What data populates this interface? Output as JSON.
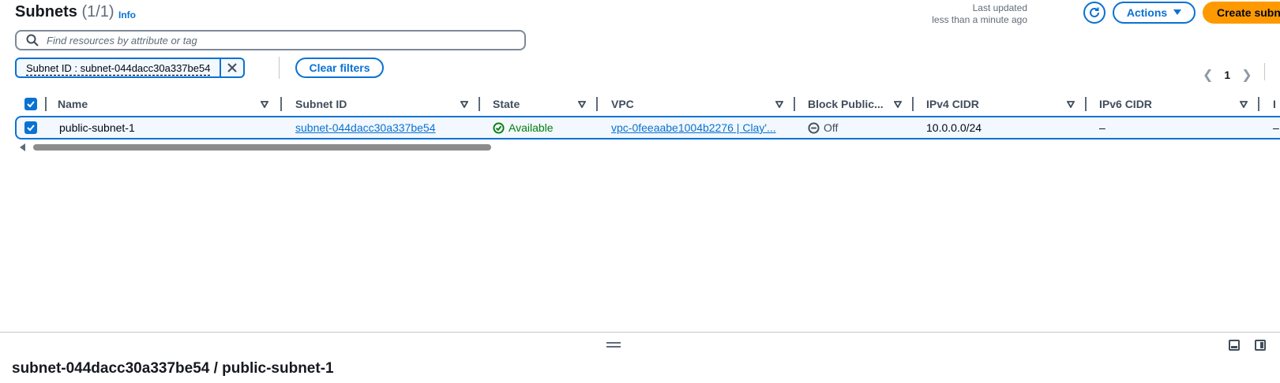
{
  "header": {
    "title": "Subnets",
    "count": "(1/1)",
    "info": "Info",
    "last_updated_label": "Last updated",
    "last_updated_value": "less than a minute ago",
    "actions_label": "Actions",
    "create_label": "Create subnet"
  },
  "search": {
    "placeholder": "Find resources by attribute or tag"
  },
  "filter": {
    "token": "Subnet ID : subnet-044dacc30a337be54",
    "clear_label": "Clear filters"
  },
  "pagination": {
    "current_page": "1"
  },
  "table": {
    "columns": [
      "Name",
      "Subnet ID",
      "State",
      "VPC",
      "Block Public...",
      "IPv4 CIDR",
      "IPv6 CIDR",
      "I"
    ],
    "rows": [
      {
        "selected": true,
        "name": "public-subnet-1",
        "subnet_id": "subnet-044dacc30a337be54",
        "state": "Available",
        "vpc": "vpc-0feeaabe1004b2276 | Clay'...",
        "block_public": "Off",
        "ipv4_cidr": "10.0.0.0/24",
        "ipv6_cidr": "–",
        "extra": "–"
      }
    ]
  },
  "detail": {
    "title": "subnet-044dacc30a337be54 / public-subnet-1"
  },
  "colors": {
    "accent": "#0972d3",
    "primary_button": "#ff9900",
    "success": "#037f0c"
  }
}
